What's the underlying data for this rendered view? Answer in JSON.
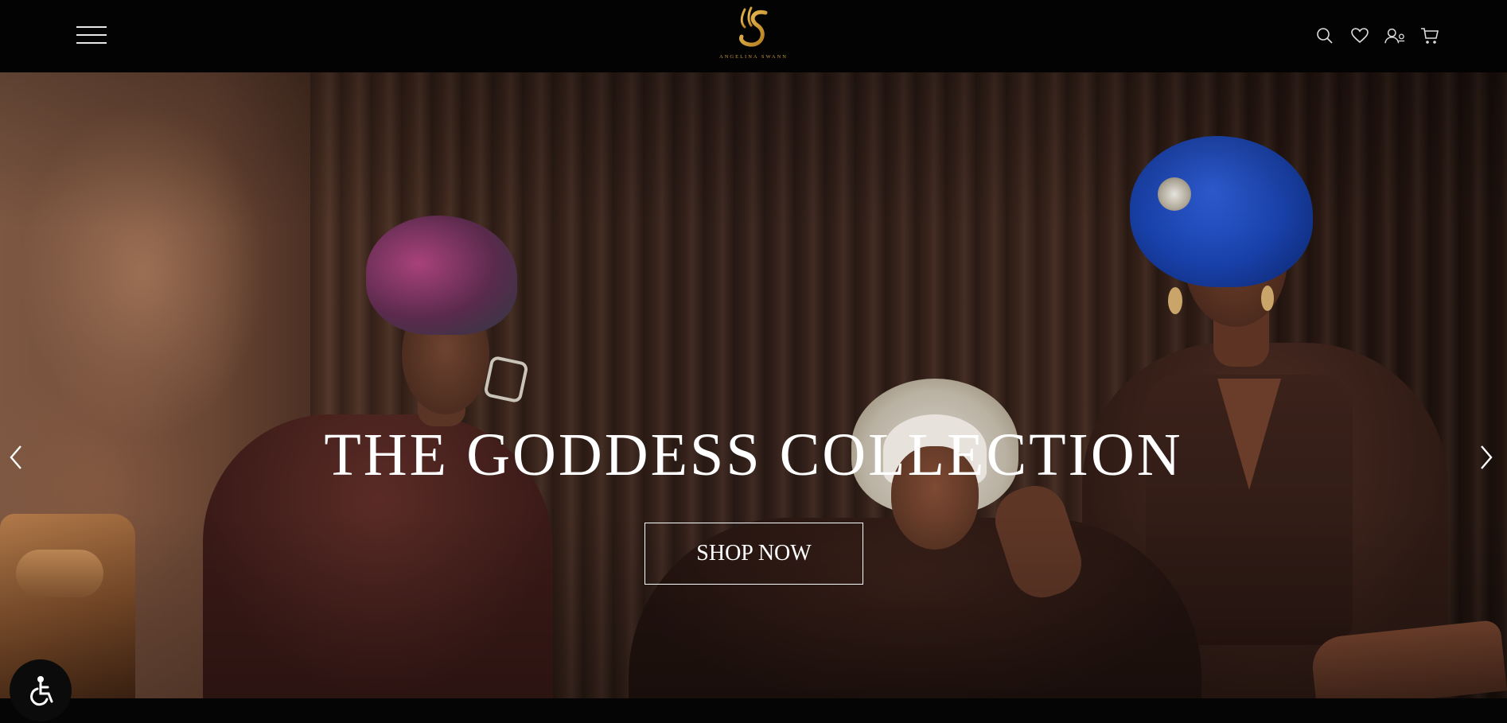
{
  "header": {
    "brand_name": "ANGELINA SWANN",
    "icons": [
      "menu-icon",
      "search-icon",
      "heart-icon",
      "account-icon",
      "cart-icon"
    ]
  },
  "hero": {
    "title": "THE GODDESS COLLECTION",
    "cta_label": "SHOP NOW"
  },
  "colors": {
    "header_bg": "#030303",
    "logo_gold": "#c79a3a",
    "text_white": "#ffffff",
    "gele_blue": "#1840a8"
  }
}
